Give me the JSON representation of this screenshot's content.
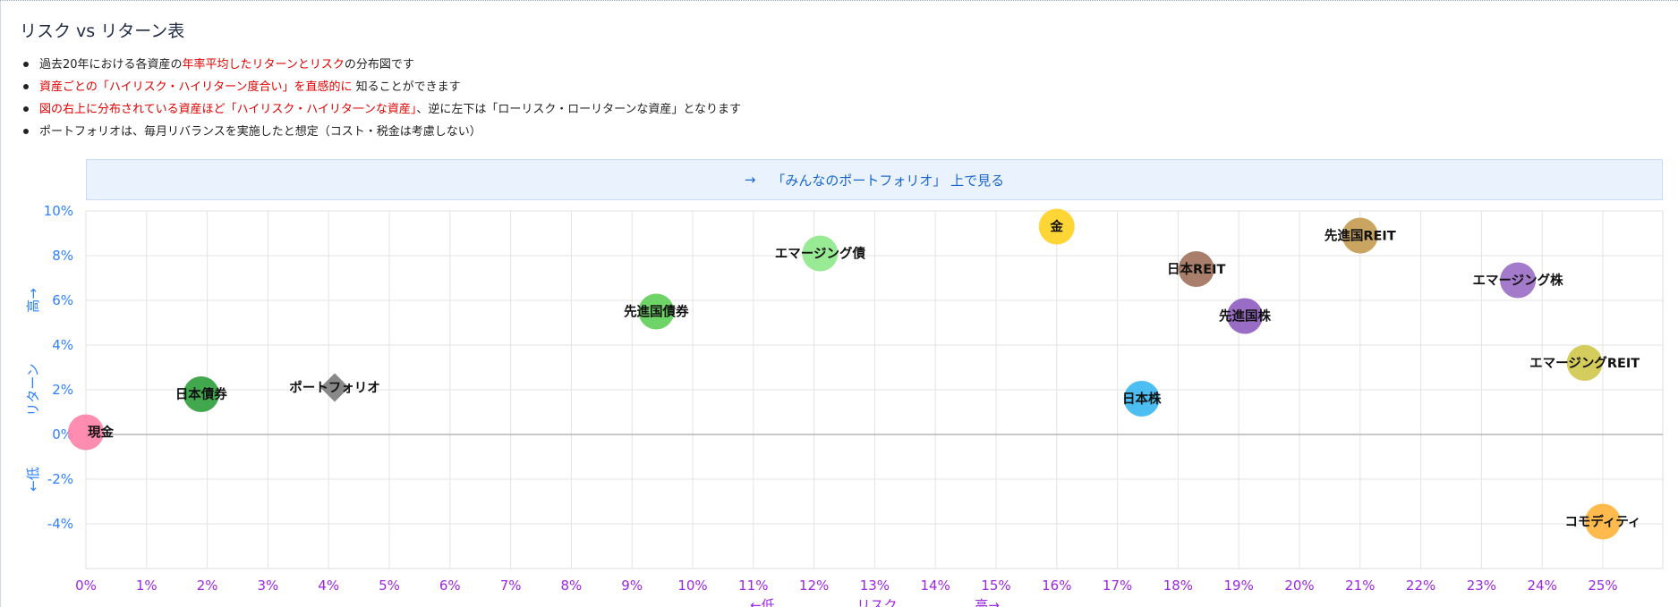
{
  "page": {
    "title": "リスク vs リターン表",
    "notes": [
      {
        "parts": [
          {
            "t": "過去20年における各資産の",
            "hl": false
          },
          {
            "t": "年率平均したリターンとリスク",
            "hl": true
          },
          {
            "t": "の分布図です",
            "hl": false
          }
        ]
      },
      {
        "parts": [
          {
            "t": "資産ごとの「ハイリスク・ハイリターン度合い」を直感的に",
            "hl": true
          },
          {
            "t": " 知ることができます",
            "hl": false
          }
        ]
      },
      {
        "parts": [
          {
            "t": "図の右上に分布されている資産ほど「ハイリスク・ハイリタ一ンな資産」",
            "hl": true
          },
          {
            "t": "、逆に左下は「ローリスク・ローリターンな資産」となります",
            "hl": false
          }
        ]
      },
      {
        "parts": [
          {
            "t": "ポートフォリオは、毎月リバランスを実施したと想定（コスト・税金は考慮しない）",
            "hl": false
          }
        ]
      }
    ],
    "link": {
      "arrow": "→",
      "label": "「みんなのポートフォリオ」 上で見る"
    }
  },
  "chart_data": {
    "type": "scatter",
    "title": "",
    "xlabel": {
      "low": "←低",
      "name": "リスク",
      "high": "高→"
    },
    "ylabel": {
      "low": "←低",
      "name": "リターン",
      "high": "高→"
    },
    "xlim": [
      0,
      26
    ],
    "ylim": [
      -6,
      10
    ],
    "x_ticks": [
      0,
      1,
      2,
      3,
      4,
      5,
      6,
      7,
      8,
      9,
      10,
      11,
      12,
      13,
      14,
      15,
      16,
      17,
      18,
      19,
      20,
      21,
      22,
      23,
      24,
      25
    ],
    "y_ticks": [
      -4,
      -2,
      0,
      2,
      4,
      6,
      8,
      10
    ],
    "x_unit": "%",
    "y_unit": "%",
    "grid": true,
    "points": [
      {
        "name": "現金",
        "x": 0.0,
        "y": 0.1,
        "color": "#ff7fa8",
        "shape": "circle",
        "label_pos": "right"
      },
      {
        "name": "日本債券",
        "x": 1.9,
        "y": 1.8,
        "color": "#2e9e3a",
        "shape": "circle",
        "label_pos": "center"
      },
      {
        "name": "ポートフォリオ",
        "x": 4.1,
        "y": 2.1,
        "color": "#888888",
        "shape": "diamond",
        "label_pos": "center"
      },
      {
        "name": "先進国債券",
        "x": 9.4,
        "y": 5.5,
        "color": "#5fcf58",
        "shape": "circle",
        "label_pos": "center"
      },
      {
        "name": "エマージング債",
        "x": 12.1,
        "y": 8.1,
        "color": "#8ee88a",
        "shape": "circle",
        "label_pos": "center"
      },
      {
        "name": "金",
        "x": 16.0,
        "y": 9.3,
        "color": "#ffd21f",
        "shape": "circle",
        "label_pos": "center"
      },
      {
        "name": "日本株",
        "x": 17.4,
        "y": 1.6,
        "color": "#3ab7ef",
        "shape": "circle",
        "label_pos": "center"
      },
      {
        "name": "日本REIT",
        "x": 18.3,
        "y": 7.4,
        "color": "#a0705a",
        "shape": "circle",
        "label_pos": "center"
      },
      {
        "name": "先進国株",
        "x": 19.1,
        "y": 5.3,
        "color": "#8e5cc0",
        "shape": "circle",
        "label_pos": "center"
      },
      {
        "name": "先進国REIT",
        "x": 21.0,
        "y": 8.9,
        "color": "#c39b50",
        "shape": "circle",
        "label_pos": "center"
      },
      {
        "name": "エマージング株",
        "x": 23.6,
        "y": 6.9,
        "color": "#9a6cc4",
        "shape": "circle",
        "label_pos": "center"
      },
      {
        "name": "エマージングREIT",
        "x": 24.7,
        "y": 3.2,
        "color": "#cfc64a",
        "shape": "circle",
        "label_pos": "center"
      },
      {
        "name": "コモディティ",
        "x": 25.0,
        "y": -3.9,
        "color": "#ffb23a",
        "shape": "circle",
        "label_pos": "center"
      }
    ]
  }
}
